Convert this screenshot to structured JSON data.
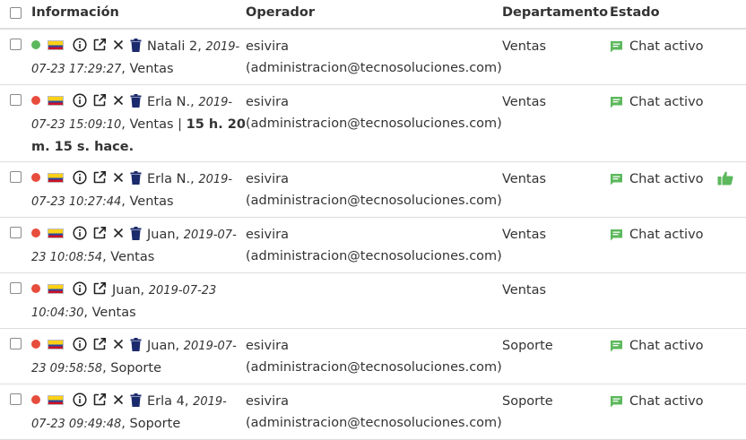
{
  "header": {
    "informacion": "Información",
    "operador": "Operador",
    "departamento": "Departamento",
    "estado": "Estado"
  },
  "colors": {
    "online": "#5cb85c",
    "offline": "#e74c3c",
    "chat_icon": "#5cb85c",
    "trash_icon": "#1a2a6c"
  },
  "rows": [
    {
      "status": "online",
      "name": "Natali 2,",
      "date": "2019-07-23 17:29:27",
      "dept_suffix": ", Ventas",
      "elapsed": "",
      "operator_name": "esivira",
      "operator_email": "(administracion@tecnosoluciones.com)",
      "departamento": "Ventas",
      "estado": "Chat activo",
      "thumb": false
    },
    {
      "status": "offline",
      "name": "Erla N.,",
      "date": "2019-07-23 15:09:10",
      "dept_suffix": ", Ventas",
      "elapsed": "15 h. 20 m. 15 s. hace.",
      "operator_name": "esivira",
      "operator_email": "(administracion@tecnosoluciones.com)",
      "departamento": "Ventas",
      "estado": "Chat activo",
      "thumb": false
    },
    {
      "status": "offline",
      "name": "Erla N.,",
      "date": "2019-07-23 10:27:44",
      "dept_suffix": ", Ventas",
      "elapsed": "",
      "operator_name": "esivira",
      "operator_email": "(administracion@tecnosoluciones.com)",
      "departamento": "Ventas",
      "estado": "Chat activo",
      "thumb": true
    },
    {
      "status": "offline",
      "name": "Juan,",
      "date": "2019-07-23 10:08:54",
      "dept_suffix": ", Ventas",
      "elapsed": "",
      "operator_name": "esivira",
      "operator_email": "(administracion@tecnosoluciones.com)",
      "departamento": "Ventas",
      "estado": "Chat activo",
      "thumb": false
    },
    {
      "status": "offline",
      "name": "Juan,",
      "date": "2019-07-23 10:04:30",
      "dept_suffix": ", Ventas",
      "elapsed": "",
      "operator_name": "",
      "operator_email": "",
      "departamento": "Ventas",
      "estado": "",
      "thumb": false,
      "no_close": true
    },
    {
      "status": "offline",
      "name": "Juan,",
      "date": "2019-07-23 09:58:58",
      "dept_suffix": ", Soporte",
      "elapsed": "",
      "operator_name": "esivira",
      "operator_email": "(administracion@tecnosoluciones.com)",
      "departamento": "Soporte",
      "estado": "Chat activo",
      "thumb": false
    },
    {
      "status": "offline",
      "name": "Erla 4,",
      "date": "2019-07-23 09:49:48",
      "dept_suffix": ", Soporte",
      "elapsed": "",
      "operator_name": "esivira",
      "operator_email": "(administracion@tecnosoluciones.com)",
      "departamento": "Soporte",
      "estado": "Chat activo",
      "thumb": false
    }
  ]
}
